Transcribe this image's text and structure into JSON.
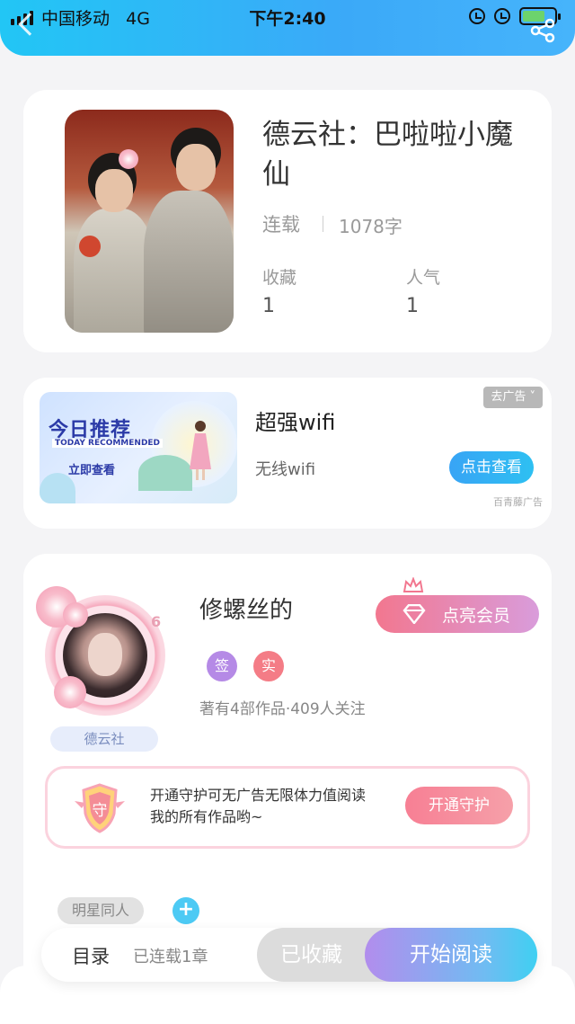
{
  "status_bar": {
    "carrier": "中国移动",
    "network": "4G",
    "time": "下午2:40",
    "battery_level": 0.7
  },
  "header": {
    "back_icon": "chevron-left-icon",
    "share_icon": "share-icon"
  },
  "book": {
    "title": "德云社：巴啦啦小魔仙",
    "status": "连载",
    "word_count": "1078字",
    "stats": [
      {
        "label": "收藏",
        "value": "1"
      },
      {
        "label": "人气",
        "value": "1"
      }
    ]
  },
  "ad": {
    "banner_title": "今日推荐",
    "banner_subtitle": "TODAY RECOMMENDED",
    "banner_cta": "立即查看",
    "title": "超强wifi",
    "description": "无线wifi",
    "close_label": "去广告 ˅",
    "button_label": "点击查看",
    "source": "百青藤广告"
  },
  "author": {
    "name": "修螺丝的",
    "level": "6",
    "tag": "德云社",
    "vip_button": "点亮会员",
    "badges": [
      {
        "label": "签",
        "color": "#b58ae6"
      },
      {
        "label": "实",
        "color": "#f47c86"
      }
    ],
    "stats": "著有4部作品·409人关注",
    "guard": {
      "shield_label": "守",
      "text": "开通守护可无广告无限体力值阅读我的所有作品哟~",
      "button": "开通守护"
    },
    "genre_tag": "明星同人",
    "add_tag": "+"
  },
  "bottom_bar": {
    "toc_label": "目录",
    "toc_count": "已连载1章",
    "collect_button": "已收藏",
    "read_button": "开始阅读"
  },
  "colors": {
    "header_gradient_start": "#22c6f5",
    "header_gradient_end": "#46b4fb",
    "accent_blue": "#2ec0f2",
    "vip_pink": "#f2778f",
    "guard_pink": "#f77f94"
  }
}
